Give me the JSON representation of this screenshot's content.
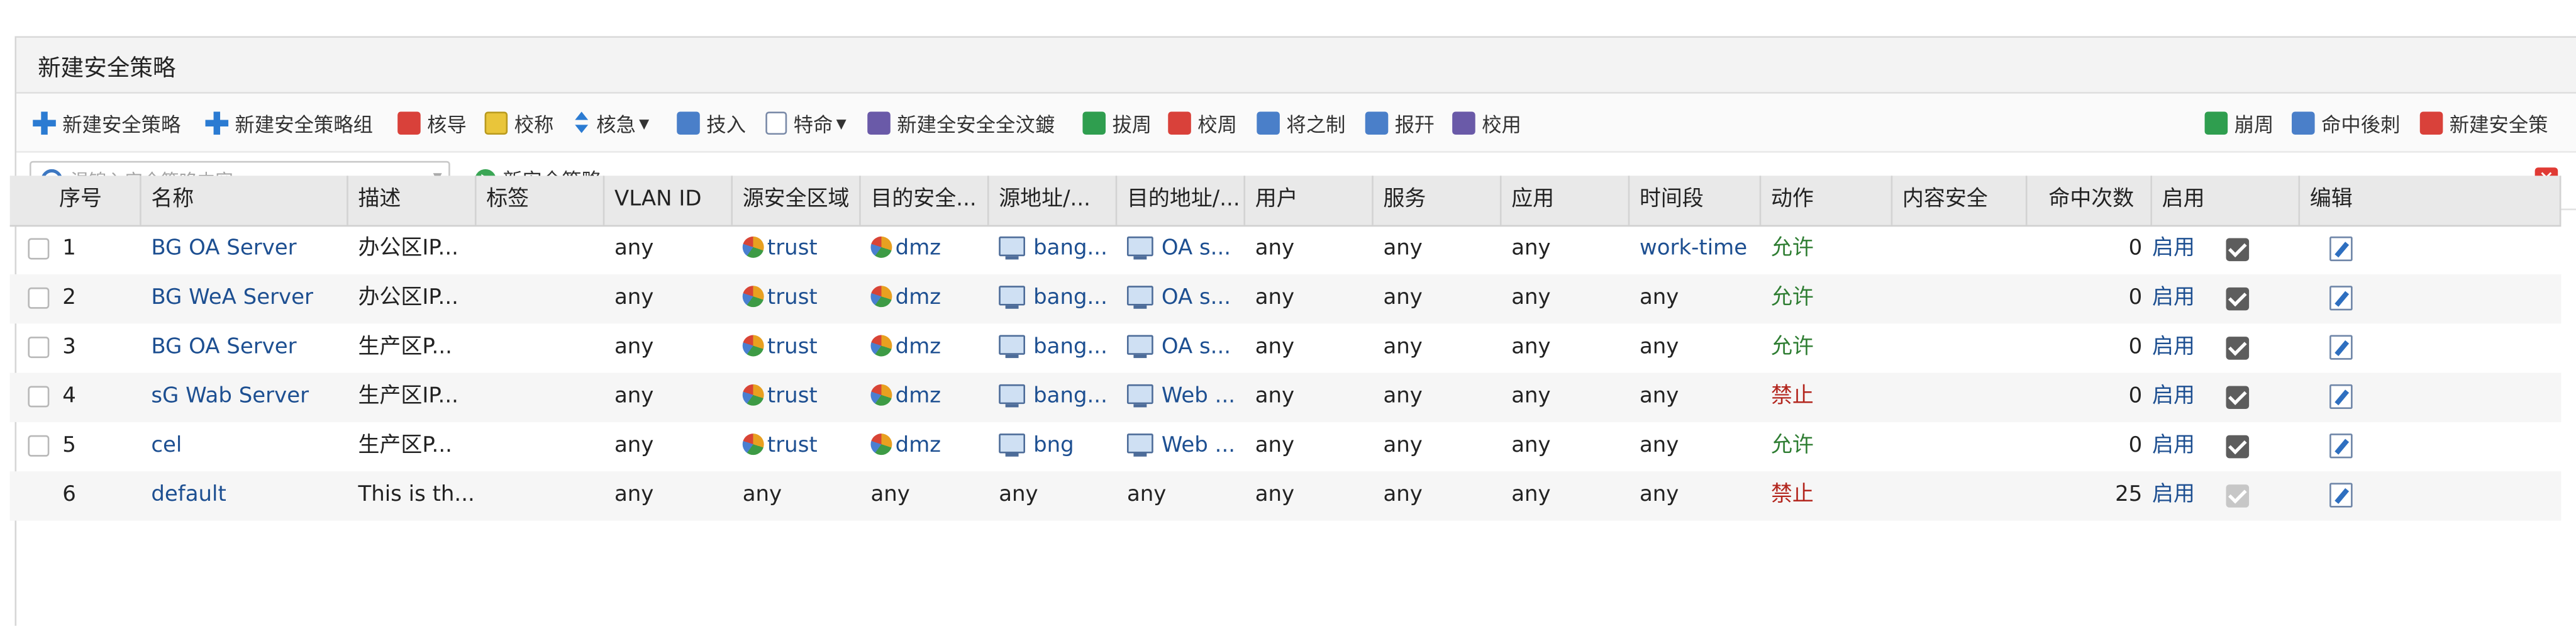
{
  "panel": {
    "title": "新建安全策略"
  },
  "toolbar": {
    "items": [
      {
        "label": "新建安全策略",
        "icon": "plus-icon"
      },
      {
        "label": "新建安全策略组",
        "icon": "plus-icon"
      },
      {
        "label": "核导",
        "icon": "delete-icon"
      },
      {
        "label": "校称",
        "icon": "copy-icon"
      },
      {
        "label": "核急",
        "icon": "move-icon",
        "dropdown": true
      },
      {
        "label": "技入",
        "icon": "insert-icon"
      },
      {
        "label": "特命",
        "icon": "lock-icon",
        "dropdown": true
      },
      {
        "label": "新建全安全全汶鍍",
        "icon": "group-icon"
      },
      {
        "label": "拔周",
        "icon": "enable-icon"
      },
      {
        "label": "校周",
        "icon": "disable-icon"
      },
      {
        "label": "将之制",
        "icon": "stat-icon"
      },
      {
        "label": "报幵",
        "icon": "report-icon"
      },
      {
        "label": "校用",
        "icon": "list-icon"
      }
    ],
    "right_items": [
      {
        "label": "崩周",
        "icon": "refresh-icon"
      },
      {
        "label": "命中後刺",
        "icon": "hit-icon"
      },
      {
        "label": "新建安全策",
        "icon": "policy-icon"
      }
    ]
  },
  "search": {
    "placeholder": "渴锦入安全策咯内容",
    "add_label": "新安全策略"
  },
  "table": {
    "headers": [
      "序号",
      "名称",
      "描述",
      "标签",
      "VLAN ID",
      "源安全区域",
      "目的安全...",
      "源地址/...",
      "目的地址/...",
      "用户",
      "服务",
      "应用",
      "时间段",
      "动作",
      "内容安全",
      "命中次数",
      "启用",
      "编辑"
    ],
    "rows": [
      {
        "no": "1",
        "name": "BG OA Server",
        "desc": "办公区IP...",
        "tag": "",
        "vlan": "any",
        "src_zone": "trust",
        "dst_zone": "dmz",
        "src_addr": "bang...",
        "dst_addr": "OA s...",
        "user": "any",
        "service": "any",
        "app": "any",
        "time": "work-time",
        "action": "允许",
        "content": "",
        "hits": "0",
        "enabled_label": "启用",
        "enabled": true,
        "checkbox": true
      },
      {
        "no": "2",
        "name": "BG WeA Server",
        "desc": "办公区IP...",
        "tag": "",
        "vlan": "any",
        "src_zone": "trust",
        "dst_zone": "dmz",
        "src_addr": "bang...",
        "dst_addr": "OA s...",
        "user": "any",
        "service": "any",
        "app": "any",
        "time": "any",
        "action": "允许",
        "content": "",
        "hits": "0",
        "enabled_label": "启用",
        "enabled": true,
        "checkbox": true
      },
      {
        "no": "3",
        "name": "BG OA Server",
        "desc": "生产区P...",
        "tag": "",
        "vlan": "any",
        "src_zone": "trust",
        "dst_zone": "dmz",
        "src_addr": "bang...",
        "dst_addr": "OA s...",
        "user": "any",
        "service": "any",
        "app": "any",
        "time": "any",
        "action": "允许",
        "content": "",
        "hits": "0",
        "enabled_label": "启用",
        "enabled": true,
        "checkbox": true
      },
      {
        "no": "4",
        "name": "sG Wab Server",
        "desc": "生产区IP...",
        "tag": "",
        "vlan": "any",
        "src_zone": "trust",
        "dst_zone": "dmz",
        "src_addr": "bang...",
        "dst_addr": "Web ...",
        "user": "any",
        "service": "any",
        "app": "any",
        "time": "any",
        "action": "禁止",
        "content": "",
        "hits": "0",
        "enabled_label": "启用",
        "enabled": true,
        "checkbox": true
      },
      {
        "no": "5",
        "name": "cel",
        "desc": "生产区P...",
        "tag": "",
        "vlan": "any",
        "src_zone": "trust",
        "dst_zone": "dmz",
        "src_addr": "bng",
        "dst_addr": "Web ...",
        "user": "any",
        "service": "any",
        "app": "any",
        "time": "any",
        "action": "允许",
        "content": "",
        "hits": "0",
        "enabled_label": "启用",
        "enabled": true,
        "checkbox": true
      },
      {
        "no": "6",
        "name": "default",
        "desc": "This is th...",
        "tag": "",
        "vlan": "any",
        "src_zone": "any",
        "dst_zone": "any",
        "src_addr": "any",
        "dst_addr": "any",
        "user": "any",
        "service": "any",
        "app": "any",
        "time": "any",
        "action": "禁止",
        "content": "",
        "hits": "25",
        "enabled_label": "启用",
        "enabled": false,
        "checkbox": false
      }
    ]
  }
}
